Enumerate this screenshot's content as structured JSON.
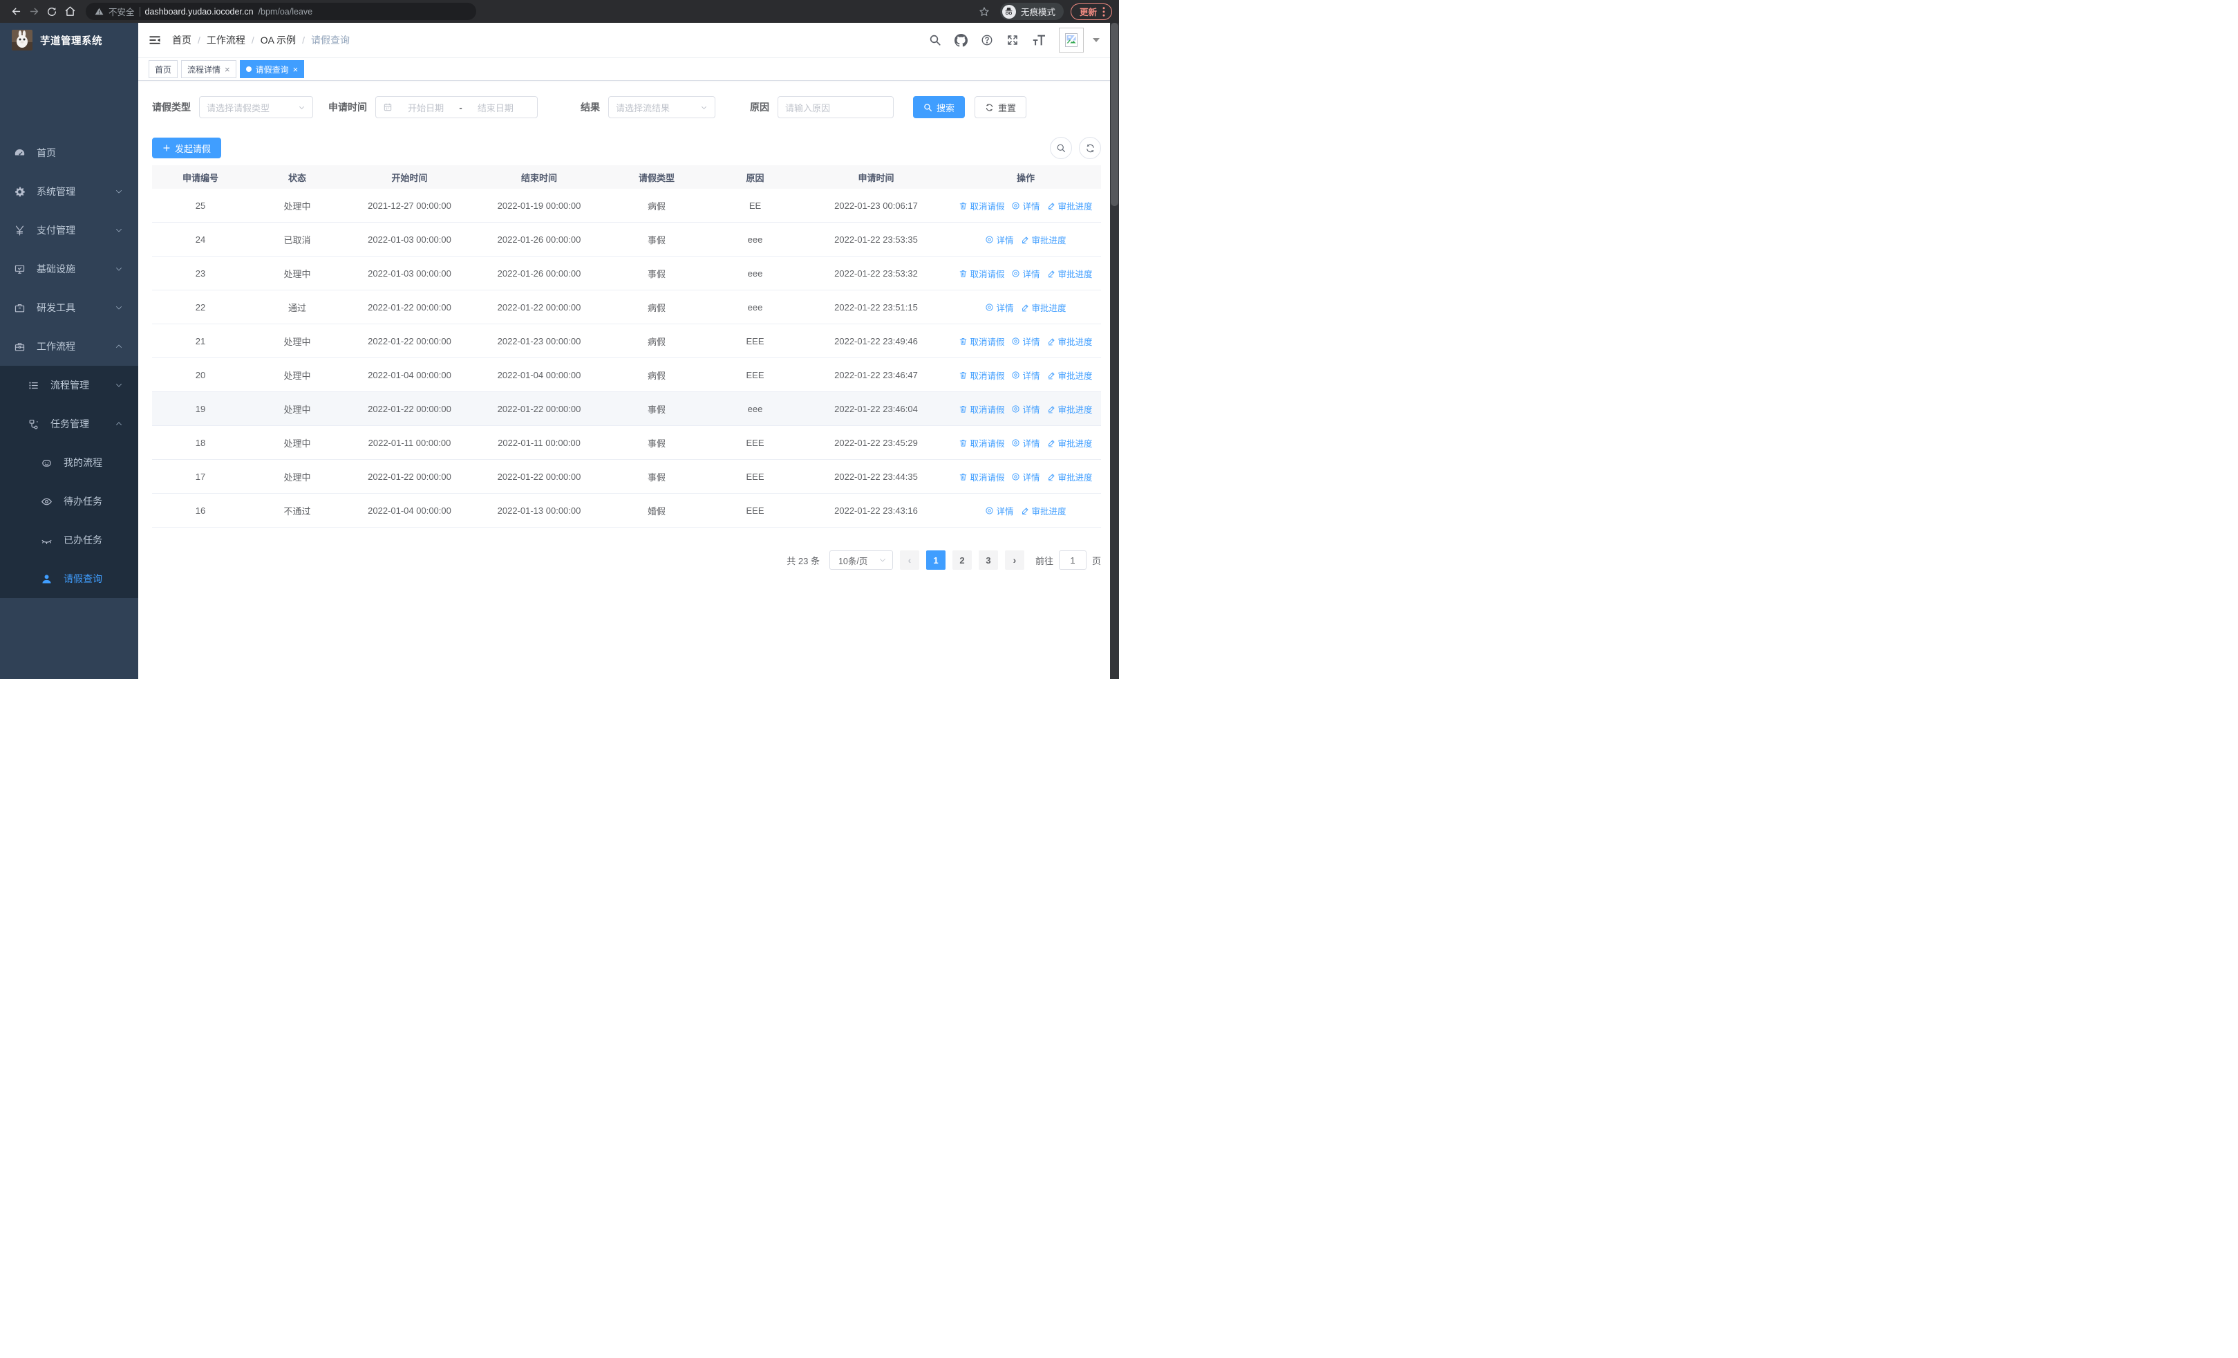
{
  "browser": {
    "security_label": "不安全",
    "url_host": "dashboard.yudao.iocoder.cn",
    "url_path": "/bpm/oa/leave",
    "incognito_label": "无痕模式",
    "update_label": "更新"
  },
  "sidebar": {
    "logo_title": "芋道管理系统",
    "items": [
      {
        "label": "首页",
        "icon": "dashboard-icon",
        "level": 0,
        "chevron": "",
        "sub": false,
        "active": false
      },
      {
        "label": "系统管理",
        "icon": "gear-icon",
        "level": 0,
        "chevron": "down",
        "sub": false,
        "active": false
      },
      {
        "label": "支付管理",
        "icon": "yen-icon",
        "level": 0,
        "chevron": "down",
        "sub": false,
        "active": false
      },
      {
        "label": "基础设施",
        "icon": "monitor-icon",
        "level": 0,
        "chevron": "down",
        "sub": false,
        "active": false
      },
      {
        "label": "研发工具",
        "icon": "briefcase-icon",
        "level": 0,
        "chevron": "down",
        "sub": false,
        "active": false
      },
      {
        "label": "工作流程",
        "icon": "toolbox-icon",
        "level": 0,
        "chevron": "up",
        "sub": false,
        "active": false
      },
      {
        "label": "流程管理",
        "icon": "tree-icon",
        "level": 1,
        "chevron": "down",
        "sub": true,
        "active": false
      },
      {
        "label": "任务管理",
        "icon": "flow-icon",
        "level": 1,
        "chevron": "up",
        "sub": true,
        "active": false
      },
      {
        "label": "我的流程",
        "icon": "robot-icon",
        "level": 2,
        "chevron": "",
        "sub": true,
        "active": false
      },
      {
        "label": "待办任务",
        "icon": "eye-icon",
        "level": 2,
        "chevron": "",
        "sub": true,
        "active": false
      },
      {
        "label": "已办任务",
        "icon": "eye-closed-icon",
        "level": 2,
        "chevron": "",
        "sub": true,
        "active": false
      },
      {
        "label": "请假查询",
        "icon": "user-icon",
        "level": 2,
        "chevron": "",
        "sub": true,
        "active": true
      }
    ]
  },
  "header": {
    "separator": "/",
    "breadcrumb": [
      {
        "label": "首页",
        "current": false
      },
      {
        "label": "工作流程",
        "current": false
      },
      {
        "label": "OA 示例",
        "current": false
      },
      {
        "label": "请假查询",
        "current": true
      }
    ]
  },
  "tabs": [
    {
      "label": "首页",
      "closable": false,
      "active": false
    },
    {
      "label": "流程详情",
      "closable": true,
      "active": false
    },
    {
      "label": "请假查询",
      "closable": true,
      "active": true
    }
  ],
  "filters": {
    "leave_type": {
      "label": "请假类型",
      "placeholder": "请选择请假类型"
    },
    "apply_time": {
      "label": "申请时间",
      "start_placeholder": "开始日期",
      "separator": "-",
      "end_placeholder": "结束日期"
    },
    "result": {
      "label": "结果",
      "placeholder": "请选择流结果"
    },
    "reason": {
      "label": "原因",
      "placeholder": "请输入原因"
    },
    "search_label": "搜索",
    "reset_label": "重置"
  },
  "toolbar": {
    "create_label": "发起请假"
  },
  "table": {
    "columns": [
      "申请编号",
      "状态",
      "开始时间",
      "结束时间",
      "请假类型",
      "原因",
      "申请时间",
      "操作"
    ],
    "action_labels": {
      "cancel": "取消请假",
      "detail": "详情",
      "progress": "审批进度"
    },
    "rows": [
      {
        "id": "25",
        "status": "处理中",
        "start": "2021-12-27 00:00:00",
        "end": "2022-01-19 00:00:00",
        "type": "病假",
        "reason": "EE",
        "apply": "2022-01-23 00:06:17",
        "actions": [
          "cancel",
          "detail",
          "progress"
        ],
        "highlight": false
      },
      {
        "id": "24",
        "status": "已取消",
        "start": "2022-01-03 00:00:00",
        "end": "2022-01-26 00:00:00",
        "type": "事假",
        "reason": "eee",
        "apply": "2022-01-22 23:53:35",
        "actions": [
          "detail",
          "progress"
        ],
        "highlight": false
      },
      {
        "id": "23",
        "status": "处理中",
        "start": "2022-01-03 00:00:00",
        "end": "2022-01-26 00:00:00",
        "type": "事假",
        "reason": "eee",
        "apply": "2022-01-22 23:53:32",
        "actions": [
          "cancel",
          "detail",
          "progress"
        ],
        "highlight": false
      },
      {
        "id": "22",
        "status": "通过",
        "start": "2022-01-22 00:00:00",
        "end": "2022-01-22 00:00:00",
        "type": "病假",
        "reason": "eee",
        "apply": "2022-01-22 23:51:15",
        "actions": [
          "detail",
          "progress"
        ],
        "highlight": false
      },
      {
        "id": "21",
        "status": "处理中",
        "start": "2022-01-22 00:00:00",
        "end": "2022-01-23 00:00:00",
        "type": "病假",
        "reason": "EEE",
        "apply": "2022-01-22 23:49:46",
        "actions": [
          "cancel",
          "detail",
          "progress"
        ],
        "highlight": false
      },
      {
        "id": "20",
        "status": "处理中",
        "start": "2022-01-04 00:00:00",
        "end": "2022-01-04 00:00:00",
        "type": "病假",
        "reason": "EEE",
        "apply": "2022-01-22 23:46:47",
        "actions": [
          "cancel",
          "detail",
          "progress"
        ],
        "highlight": false
      },
      {
        "id": "19",
        "status": "处理中",
        "start": "2022-01-22 00:00:00",
        "end": "2022-01-22 00:00:00",
        "type": "事假",
        "reason": "eee",
        "apply": "2022-01-22 23:46:04",
        "actions": [
          "cancel",
          "detail",
          "progress"
        ],
        "highlight": true
      },
      {
        "id": "18",
        "status": "处理中",
        "start": "2022-01-11 00:00:00",
        "end": "2022-01-11 00:00:00",
        "type": "事假",
        "reason": "EEE",
        "apply": "2022-01-22 23:45:29",
        "actions": [
          "cancel",
          "detail",
          "progress"
        ],
        "highlight": false
      },
      {
        "id": "17",
        "status": "处理中",
        "start": "2022-01-22 00:00:00",
        "end": "2022-01-22 00:00:00",
        "type": "事假",
        "reason": "EEE",
        "apply": "2022-01-22 23:44:35",
        "actions": [
          "cancel",
          "detail",
          "progress"
        ],
        "highlight": false
      },
      {
        "id": "16",
        "status": "不通过",
        "start": "2022-01-04 00:00:00",
        "end": "2022-01-13 00:00:00",
        "type": "婚假",
        "reason": "EEE",
        "apply": "2022-01-22 23:43:16",
        "actions": [
          "detail",
          "progress"
        ],
        "highlight": false
      }
    ]
  },
  "pagination": {
    "total": "共 23 条",
    "page_size": "10条/页",
    "pages": [
      "1",
      "2",
      "3"
    ],
    "active_page": "1",
    "goto_label": "前往",
    "goto_value": "1",
    "unit_label": "页"
  }
}
